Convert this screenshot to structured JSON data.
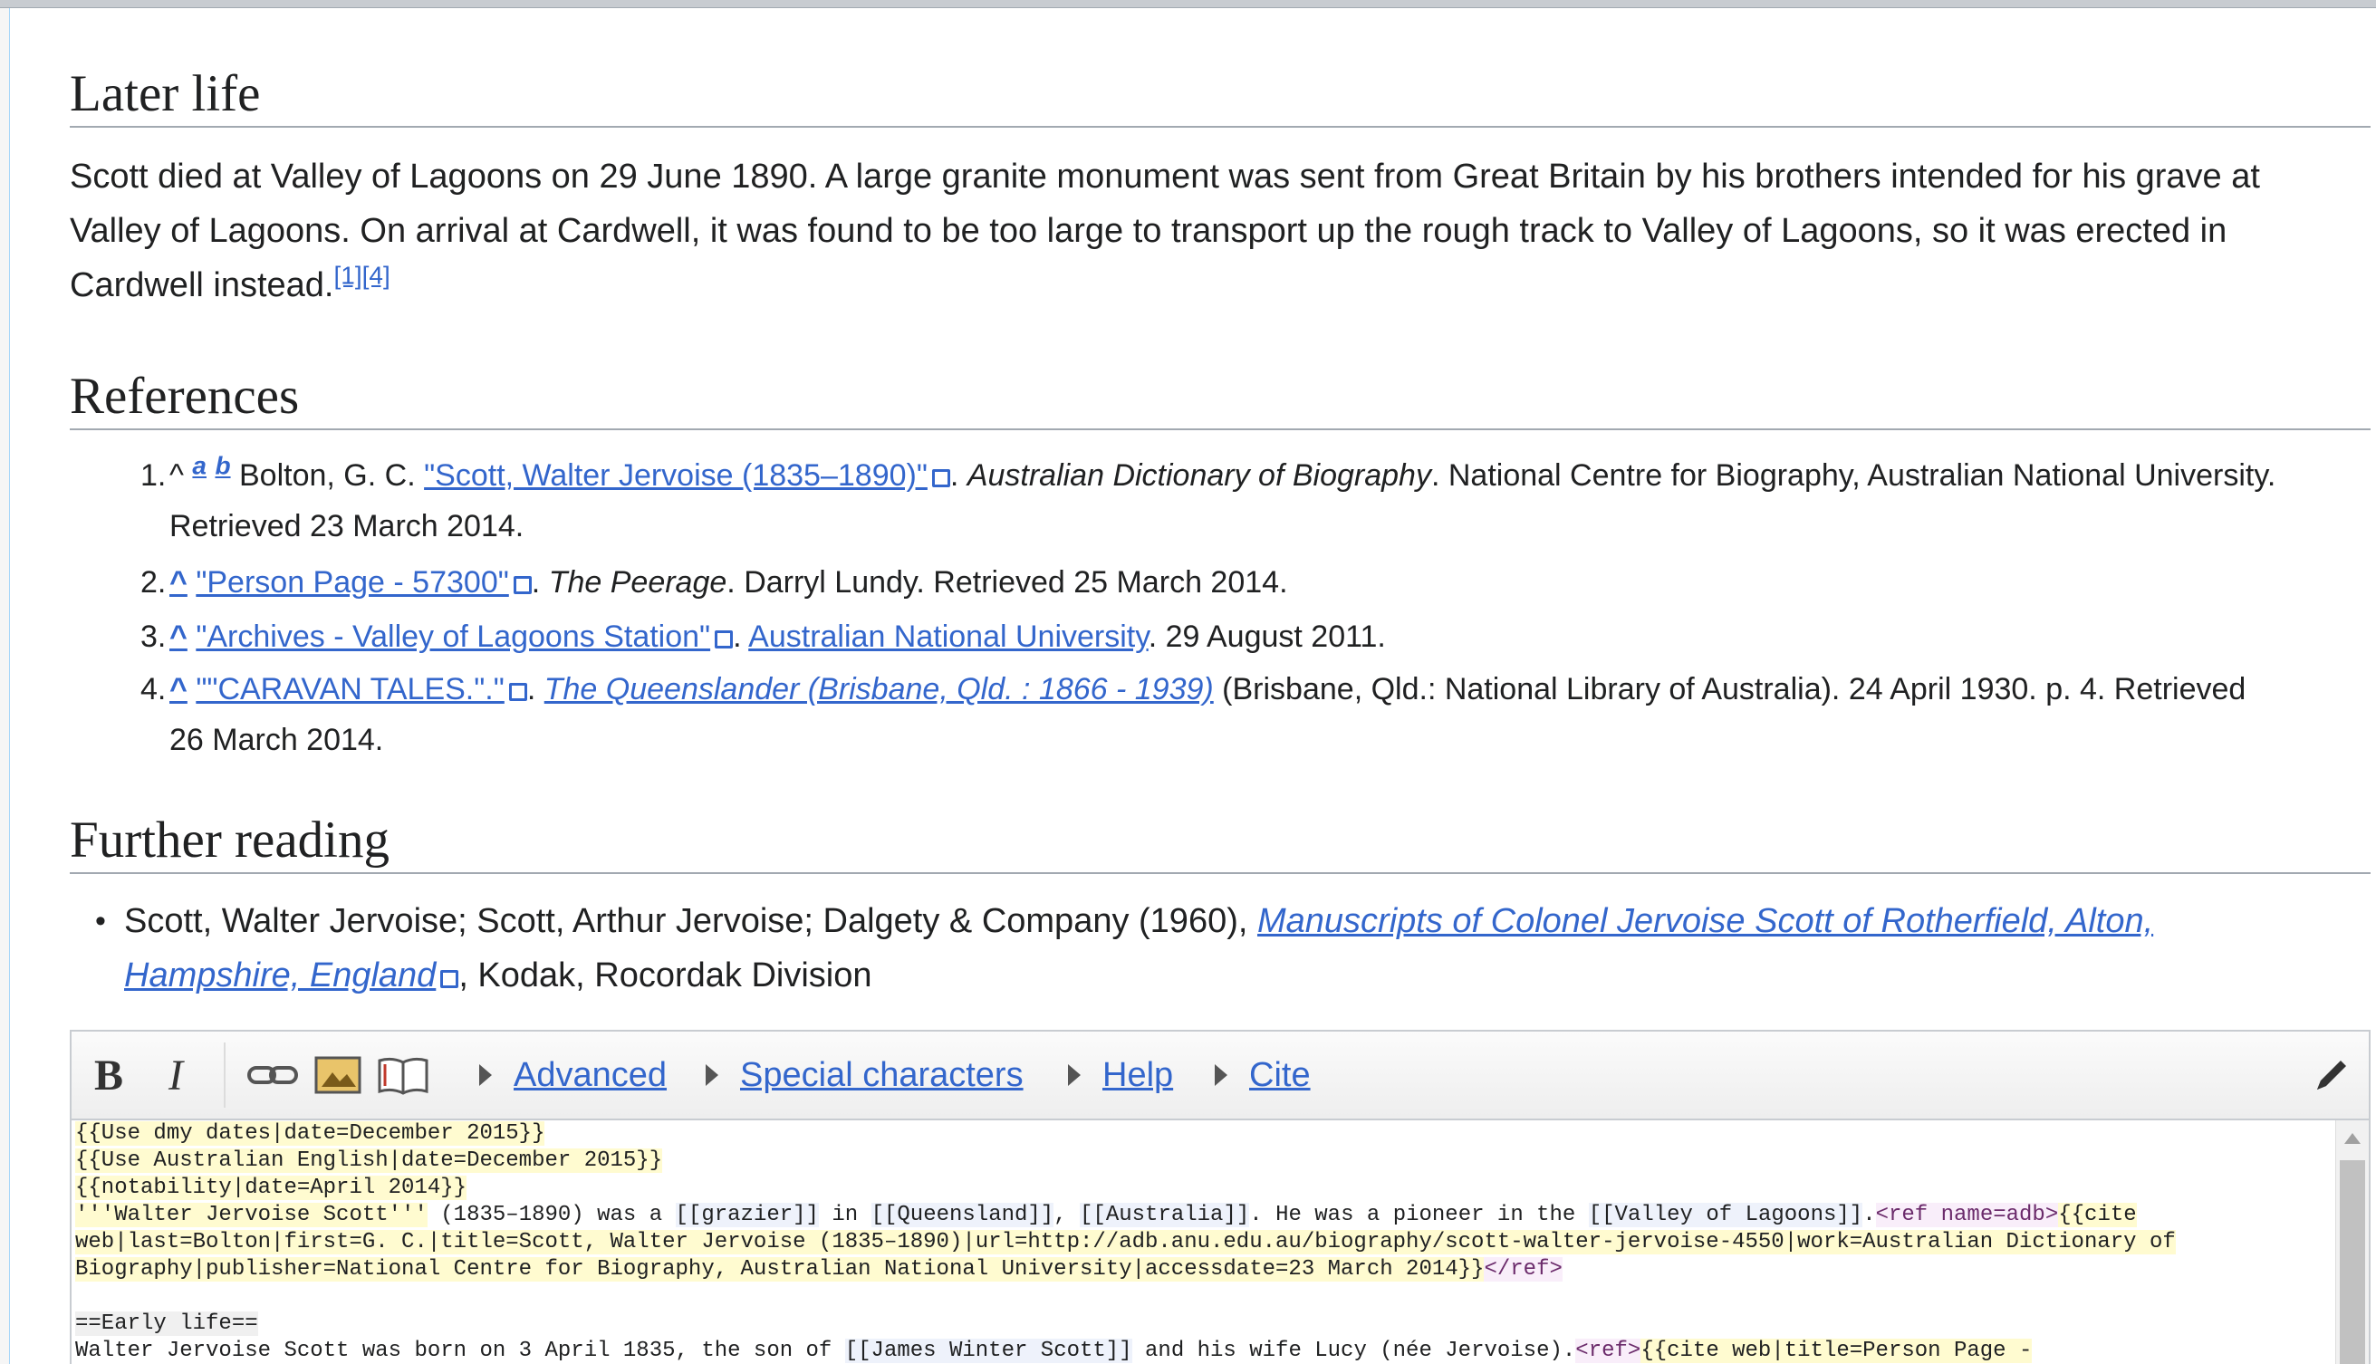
{
  "later_life": {
    "heading": "Later life",
    "line1": "Scott died at Valley of Lagoons on 29 June 1890. A large granite monument was sent from Great Britain by his brothers intended for his grave at",
    "line2": "Valley of Lagoons. On arrival at Cardwell, it was found to be too large to transport up the rough track to Valley of Lagoons, so it was erected in",
    "line3": "Cardwell instead.",
    "cite1": "[1]",
    "cite2": "[4]"
  },
  "references": {
    "heading": "References",
    "items": [
      {
        "num": "1.",
        "caret": "^",
        "a": "a",
        "b": "b",
        "author": " Bolton, G. C. ",
        "link": "\"Scott, Walter Jervoise (1835–1890)\"",
        "dot": ". ",
        "work": "Australian Dictionary of Biography",
        "rest": ". National Centre for Biography, Australian National University.",
        "rest2": "Retrieved 23 March 2014."
      },
      {
        "num": "2.",
        "caret": "^",
        "link": "\"Person Page - 57300\"",
        "dot": ". ",
        "work": "The Peerage",
        "rest": ". Darryl Lundy. Retrieved 25 March 2014."
      },
      {
        "num": "3.",
        "caret": "^",
        "link": "\"Archives - Valley of Lagoons Station\"",
        "dot": ". ",
        "link2": "Australian National University",
        "rest": ". 29 August 2011."
      },
      {
        "num": "4.",
        "caret": "^",
        "link": "\"\"CARAVAN TALES.\".\"",
        "dot": ". ",
        "link2": "The Queenslander (Brisbane, Qld. : 1866 - 1939)",
        "rest": " (Brisbane, Qld.: National Library of Australia). 24 April 1930. p. 4. Retrieved",
        "rest2": "26 March 2014."
      }
    ]
  },
  "further_reading": {
    "heading": "Further reading",
    "prefix": "Scott, Walter Jervoise; Scott, Arthur Jervoise; Dalgety & Company (1960), ",
    "link_a": "Manuscripts of Colonel Jervoise Scott of Rotherfield, Alton,",
    "link_b": "Hampshire, England",
    "suffix": ", Kodak, Rocordak Division"
  },
  "editor": {
    "bold": "B",
    "italic": "I",
    "tabs": [
      "Advanced",
      "Special characters",
      "Help",
      "Cite"
    ],
    "lines": {
      "l1": "{{Use dmy dates|date=December 2015}}",
      "l2": "{{Use Australian English|date=December 2015}}",
      "l3": "{{notability|date=April 2014}}",
      "l4a": "'''Walter Jervoise Scott'''",
      "l4b": " (1835–1890) was a ",
      "l4c": "[[grazier]]",
      "l4d": " in ",
      "l4e": "[[Queensland]]",
      "l4f": ", ",
      "l4g": "[[Australia]]",
      "l4h": ". He was a pioneer in the ",
      "l4i": "[[Valley of Lagoons]]",
      "l4j": ".",
      "l4k": "<ref name=adb>",
      "l4l": "{{cite",
      "l5": "web|last=Bolton|first=G. C.|title=Scott, Walter Jervoise (1835–1890)|url=http://adb.anu.edu.au/biography/scott-walter-jervoise-4550|work=Australian Dictionary of",
      "l6a": "Biography|publisher=National Centre for Biography, Australian National University|accessdate=23 March 2014}}",
      "l6b": "</ref>",
      "l7": "",
      "l8": "==Early life==",
      "l9a": "Walter Jervoise Scott was born on 3 April 1835, the son of ",
      "l9b": "[[James Winter Scott]]",
      "l9c": " and his wife Lucy (née Jervoise).",
      "l9d": "<ref>",
      "l9e": "{{cite web|title=Person Page -"
    }
  }
}
